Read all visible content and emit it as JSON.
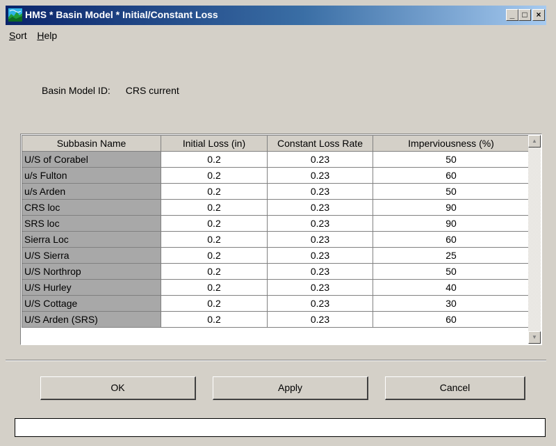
{
  "window": {
    "title": "HMS * Basin Model * Initial/Constant Loss",
    "buttons": {
      "minimize": "_",
      "maximize": "□",
      "close": "×"
    }
  },
  "menu": [
    {
      "label": "Sort"
    },
    {
      "label": "Help"
    }
  ],
  "basin": {
    "label": "Basin Model ID:",
    "value": "CRS current"
  },
  "table": {
    "headers": [
      "Subbasin Name",
      "Initial Loss (in)",
      "Constant Loss Rate",
      "Imperviousness (%)"
    ],
    "rows": [
      [
        "U/S of Corabel",
        "0.2",
        "0.23",
        "50"
      ],
      [
        "u/s Fulton",
        "0.2",
        "0.23",
        "60"
      ],
      [
        "u/s Arden",
        "0.2",
        "0.23",
        "50"
      ],
      [
        "CRS loc",
        "0.2",
        "0.23",
        "90"
      ],
      [
        "SRS loc",
        "0.2",
        "0.23",
        "90"
      ],
      [
        "Sierra Loc",
        "0.2",
        "0.23",
        "60"
      ],
      [
        "U/S Sierra",
        "0.2",
        "0.23",
        "25"
      ],
      [
        "U/S Northrop",
        "0.2",
        "0.23",
        "50"
      ],
      [
        "U/S Hurley",
        "0.2",
        "0.23",
        "40"
      ],
      [
        "U/S Cottage",
        "0.2",
        "0.23",
        "30"
      ],
      [
        "U/S Arden (SRS)",
        "0.2",
        "0.23",
        "60"
      ]
    ]
  },
  "scrollbar": {
    "up": "▲",
    "down": "▼"
  },
  "buttons": {
    "ok": "OK",
    "apply": "Apply",
    "cancel": "Cancel"
  },
  "status": {
    "text": ""
  },
  "colors": {
    "titlebar_start": "#0a246a",
    "titlebar_end": "#a6caf0",
    "face": "#d4d0c8",
    "name_column": "#a8a8a8"
  }
}
